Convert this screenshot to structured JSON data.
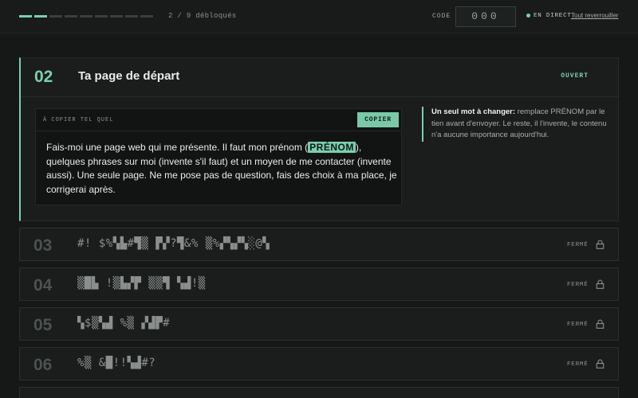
{
  "header": {
    "progress": {
      "unlocked": 2,
      "total": 9,
      "text": "2 / 9 débloqués"
    },
    "code_label": "CODE",
    "code_value": "000",
    "live_label": "EN DIRECT",
    "relock_link": "Tout reverrouiller",
    "peek_text": "· · · · · · · · · · · · · · · · · · · · · · · · · · ·"
  },
  "open_section": {
    "number": "02",
    "title": "Ta page de départ",
    "status": "OUVERT",
    "copy_label": "À COPIER TEL QUEL",
    "copy_button": "COPIER",
    "prompt_before": "Fais-moi une page web qui me présente. Il faut mon prénom (",
    "prompt_highlight": "PRÉNOM",
    "prompt_after": "), quelques phrases sur moi (invente s'il faut) et un moyen de me contacter (invente aussi). Une seule page. Ne me pose pas de question, fais des choix à ma place, je corrigerai après.",
    "aside_bold": "Un seul mot à changer:",
    "aside_text": " remplace PRÉNOM par le tien avant d'envoyer. Le reste, il l'invente, le contenu n'a aucune importance aujourd'hui."
  },
  "locked_sections": [
    {
      "number": "03",
      "scramble": "#! $%▚▙#▜▒ ▛▞?▜&% ▒%▞▚▞▚░@▚",
      "status": "FERMÉ"
    },
    {
      "number": "04",
      "scramble": "▒█▙ !▒▙▞▛ ▒▒▜ ▚▟!▒",
      "status": "FERMÉ"
    },
    {
      "number": "05",
      "scramble": "▚$▒▚▟ %▒ ▞▟▛#",
      "status": "FERMÉ"
    },
    {
      "number": "06",
      "scramble": "%▒ &█!!▚▟#?",
      "status": "FERMÉ"
    }
  ],
  "colors": {
    "accent": "#7ccfac",
    "background": "#151817"
  },
  "icons": {
    "lock": "lock-icon"
  }
}
